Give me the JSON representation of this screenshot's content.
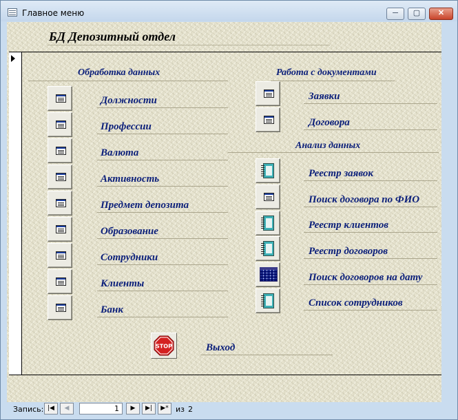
{
  "window": {
    "title": "Главное меню",
    "min_glyph": "─",
    "max_glyph": "▢",
    "close_glyph": "✕"
  },
  "header": {
    "title": "БД Депозитный отдел"
  },
  "data_processing": {
    "title": "Обработка данных",
    "items": [
      "Должности",
      "Профессии",
      "Валюта",
      "Активность",
      "Предмет депозита",
      "Образование",
      "Сотрудники",
      "Клиенты",
      "Банк"
    ]
  },
  "documents": {
    "title": "Работа с документами",
    "items": [
      "Заявки",
      "Договора"
    ]
  },
  "analysis": {
    "title": "Анализ данных",
    "items": [
      {
        "label": "Реестр заявок",
        "icon": "report-icon"
      },
      {
        "label": "Поиск договора по ФИО",
        "icon": "form-icon"
      },
      {
        "label": "Реестр клиентов",
        "icon": "report-icon"
      },
      {
        "label": "Реестр договоров",
        "icon": "report-icon"
      },
      {
        "label": "Поиск договоров на дату",
        "icon": "calendar-icon"
      },
      {
        "label": "Список сотрудников",
        "icon": "report-icon"
      }
    ]
  },
  "exit": {
    "label": "Выход",
    "icon_text": "STOP"
  },
  "navigation": {
    "label": "Запись:",
    "first_glyph": "|◀",
    "prev_glyph": "◀",
    "current": "1",
    "next_glyph": "▶",
    "last_glyph": "▶|",
    "new_glyph": "▶*",
    "of_text": "из",
    "total": "2"
  }
}
